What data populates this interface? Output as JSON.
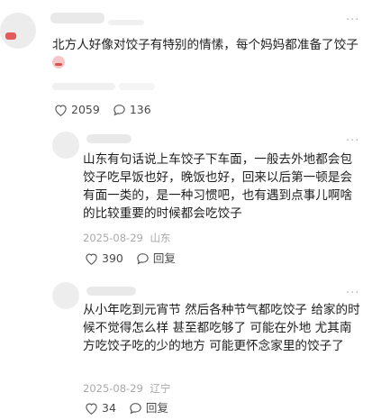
{
  "comments": [
    {
      "text": "北方人好像对饺子有特别的情愫，每个妈妈都准备了饺子",
      "emoji_icon": "sad-face-emoji",
      "likes": "2059",
      "replies": "136"
    },
    {
      "text": "山东有句话说上车饺子下车面，一般去外地都会包饺子吃早饭也好，晚饭也好，回来以后第一顿是会有面一类的，是一种习惯吧，也有遇到点事儿啊啥的比较重要的时候都会吃饺子",
      "date": "2025-08-29",
      "location": "山东",
      "likes": "390",
      "reply_label": "回复"
    },
    {
      "text": "从小年吃到元宵节 然后各种节气都吃饺子 给家的时候不觉得怎么样 甚至都吃够了 可能在外地 尤其南方吃饺子吃的少的地方 可能更怀念家里的饺子了",
      "date": "2025-08-29",
      "location": "辽宁",
      "likes": "34",
      "reply_label": "回复"
    }
  ],
  "colors": {
    "text": "#1f1f1f",
    "meta": "#a9a9a9",
    "icon": "#555555",
    "avatar_accent": "#e15b5b"
  }
}
